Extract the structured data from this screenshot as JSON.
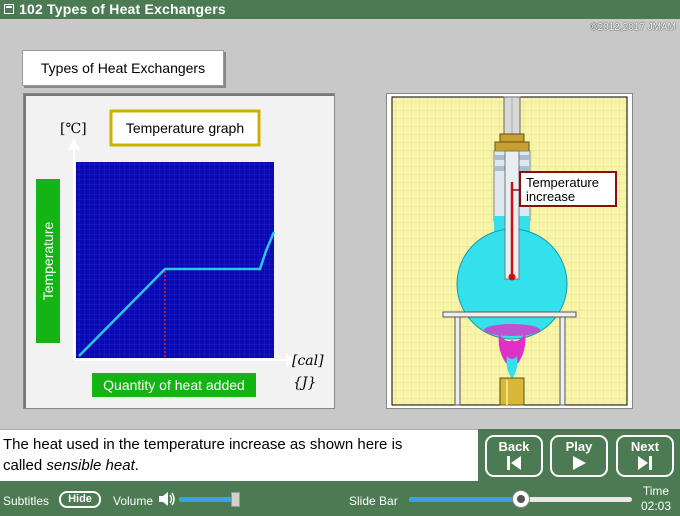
{
  "window": {
    "title": "102 Types of Heat Exchangers",
    "copyright": "©2012,2017 JMAM"
  },
  "section_title": "Types of Heat Exchangers",
  "graph": {
    "title": "Temperature graph",
    "y_unit": "[℃]",
    "y_label": "Temperature",
    "x_label": "Quantity of heat added",
    "x_unit_cal": "[cal]",
    "x_unit_j": "{J}"
  },
  "illustration": {
    "callout": "Temperature increase"
  },
  "subtitle": {
    "line1": "The heat used in the temperature increase as shown here is",
    "line2_prefix": "called ",
    "line2_em": "sensible heat",
    "line2_suffix": "."
  },
  "nav": {
    "back": "Back",
    "play": "Play",
    "next": "Next"
  },
  "controls": {
    "subtitles_label": "Subtitles",
    "hide_label": "Hide",
    "volume_label": "Volume",
    "volume_level": 0.95,
    "slide_bar_label": "Slide Bar",
    "slide_position": 0.5,
    "time_label": "Time",
    "time_value": "02:03"
  },
  "colors": {
    "bar_green": "#4c7a52",
    "plot_blue": "#0a0ab4",
    "curve_cyan": "#2ec4e6",
    "label_green": "#14b414",
    "flask_cyan": "#33e0ec",
    "flame_magenta": "#e030c8",
    "slider_blue": "#3aa0e8"
  }
}
